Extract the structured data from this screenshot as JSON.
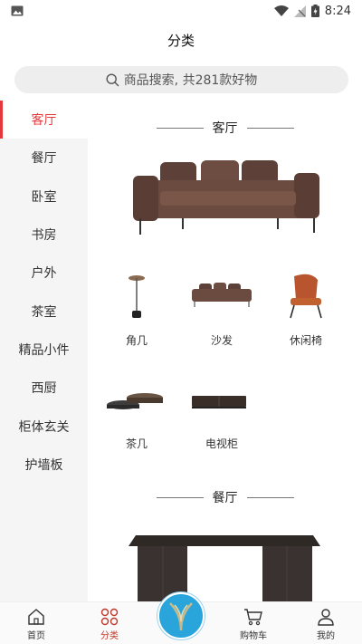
{
  "statusbar": {
    "time": "8:24",
    "icons": [
      "image-icon",
      "wifi-icon",
      "signal-off-icon",
      "battery-charging-icon"
    ]
  },
  "header": {
    "title": "分类"
  },
  "search": {
    "placeholder": "商品搜索, 共281款好物"
  },
  "sidebar": {
    "items": [
      {
        "label": "客厅",
        "active": true
      },
      {
        "label": "餐厅",
        "active": false
      },
      {
        "label": "卧室",
        "active": false
      },
      {
        "label": "书房",
        "active": false
      },
      {
        "label": "户外",
        "active": false
      },
      {
        "label": "茶室",
        "active": false
      },
      {
        "label": "精品小件",
        "active": false
      },
      {
        "label": "西厨",
        "active": false
      },
      {
        "label": "柜体玄关",
        "active": false
      },
      {
        "label": "护墙板",
        "active": false
      }
    ]
  },
  "content": {
    "section1": {
      "title": "客厅",
      "items": [
        {
          "label": "角几"
        },
        {
          "label": "沙发"
        },
        {
          "label": "休闲椅"
        },
        {
          "label": "茶几"
        },
        {
          "label": "电视柜"
        }
      ]
    },
    "section2": {
      "title": "餐厅"
    }
  },
  "bottomnav": {
    "items": [
      {
        "label": "首页",
        "icon": "home-icon"
      },
      {
        "label": "分类",
        "icon": "category-icon",
        "active": true
      },
      {
        "label": "购物车",
        "icon": "cart-icon"
      },
      {
        "label": "我的",
        "icon": "user-icon"
      }
    ],
    "center_icon": "brand-logo-icon"
  },
  "colors": {
    "accent": "#e5383b",
    "center_button": "#2aa5dc",
    "sidebar_bg": "#f5f5f5",
    "search_bg": "#eeeeee"
  }
}
